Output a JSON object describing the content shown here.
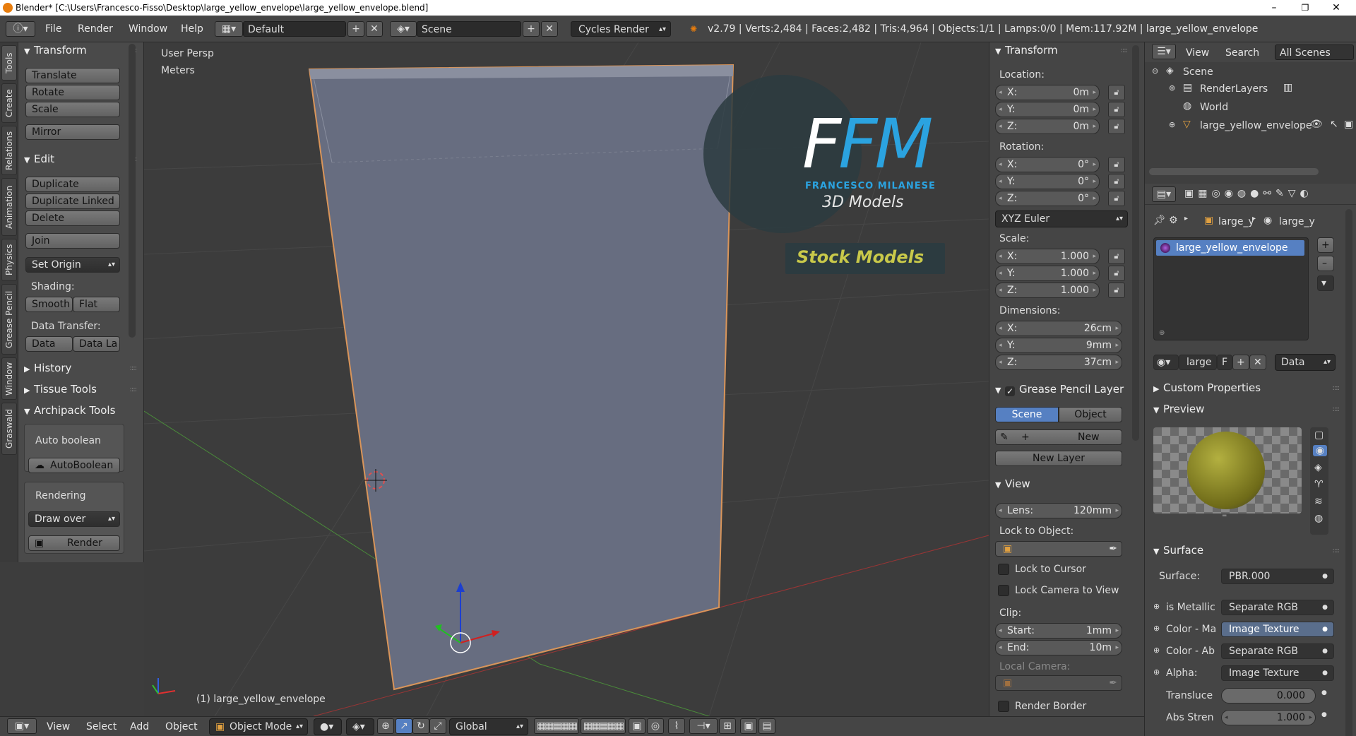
{
  "window": {
    "title": "Blender* [C:\\Users\\Francesco-Fisso\\Desktop\\large_yellow_envelope\\large_yellow_envelope.blend]",
    "min": "–",
    "max": "❐",
    "close": "✕"
  },
  "menu": {
    "items": [
      "File",
      "Render",
      "Window",
      "Help"
    ],
    "layout": "Default",
    "scene": "Scene",
    "engine": "Cycles Render",
    "stats": "v2.79 | Verts:2,484 | Faces:2,482 | Tris:4,964 | Objects:1/1 | Lamps:0/0 | Mem:117.92M | large_yellow_envelope"
  },
  "vtabs": [
    "Tools",
    "Create",
    "Relations",
    "Animation",
    "Physics",
    "Grease Pencil",
    "Window",
    "Graswald"
  ],
  "toolshelf": {
    "transform_header": "Transform",
    "translate": "Translate",
    "rotate": "Rotate",
    "scale": "Scale",
    "mirror": "Mirror",
    "edit_header": "Edit",
    "duplicate": "Duplicate",
    "duplicate_linked": "Duplicate Linked",
    "delete": "Delete",
    "join": "Join",
    "set_origin": "Set Origin",
    "shading_label": "Shading:",
    "smooth": "Smooth",
    "flat": "Flat",
    "data_transfer_label": "Data Transfer:",
    "data": "Data",
    "data_la": "Data La",
    "history": "History",
    "tissue": "Tissue Tools",
    "archipack": "Archipack Tools",
    "auto_boolean_label": "Auto boolean",
    "auto_boolean_btn": "AutoBoolean",
    "rendering_label": "Rendering",
    "draw_over": "Draw over",
    "render": "Render"
  },
  "viewport": {
    "view_name": "User Persp",
    "units": "Meters",
    "object_label": "(1) large_yellow_envelope",
    "watermark_initials": "FM",
    "watermark_name": "FRANCESCO MILANESE",
    "watermark_sub": "3D Models",
    "stock": "Stock Models"
  },
  "npanel": {
    "transform_header": "Transform",
    "location_label": "Location:",
    "location": [
      {
        "k": "X:",
        "v": "0m"
      },
      {
        "k": "Y:",
        "v": "0m"
      },
      {
        "k": "Z:",
        "v": "0m"
      }
    ],
    "rotation_label": "Rotation:",
    "rotation": [
      {
        "k": "X:",
        "v": "0°"
      },
      {
        "k": "Y:",
        "v": "0°"
      },
      {
        "k": "Z:",
        "v": "0°"
      }
    ],
    "rotation_mode": "XYZ Euler",
    "scale_label": "Scale:",
    "scale": [
      {
        "k": "X:",
        "v": "1.000"
      },
      {
        "k": "Y:",
        "v": "1.000"
      },
      {
        "k": "Z:",
        "v": "1.000"
      }
    ],
    "dimensions_label": "Dimensions:",
    "dimensions": [
      {
        "k": "X:",
        "v": "26cm"
      },
      {
        "k": "Y:",
        "v": "9mm"
      },
      {
        "k": "Z:",
        "v": "37cm"
      }
    ],
    "gp_header": "Grease Pencil Layer",
    "gp_scene": "Scene",
    "gp_object": "Object",
    "gp_new": "New",
    "gp_new_layer": "New Layer",
    "view_header": "View",
    "lens_k": "Lens:",
    "lens_v": "120mm",
    "lock_obj_label": "Lock to Object:",
    "lock_cursor": "Lock to Cursor",
    "lock_camera": "Lock Camera to View",
    "clip_label": "Clip:",
    "clip_start_k": "Start:",
    "clip_start_v": "1mm",
    "clip_end_k": "End:",
    "clip_end_v": "10m",
    "local_camera": "Local Camera:",
    "render_border": "Render Border"
  },
  "outliner": {
    "view": "View",
    "search": "Search",
    "all_scenes": "All Scenes",
    "scene": "Scene",
    "renderlayers": "RenderLayers",
    "world": "World",
    "object": "large_yellow_envelope"
  },
  "props": {
    "crumb1": "large_y",
    "crumb2": "large_y",
    "material_slot": "large_yellow_envelope",
    "mat_name": "large",
    "f": "F",
    "data_sel": "Data",
    "custom_props": "Custom Properties",
    "preview": "Preview",
    "surface_header": "Surface",
    "surface_label": "Surface:",
    "surface_val": "PBR.000",
    "rows": [
      {
        "k": "is Metallic",
        "v": "Separate RGB"
      },
      {
        "k": "Color - Ma",
        "v": "Image Texture"
      },
      {
        "k": "Color - Ab",
        "v": "Separate RGB"
      },
      {
        "k": "Alpha:",
        "v": "Image Texture"
      }
    ],
    "transl_k": "Transluce",
    "transl_v": "0.000",
    "abs_k": "Abs Stren",
    "abs_v": "1.000"
  },
  "bottom": {
    "view": "View",
    "select": "Select",
    "add": "Add",
    "object": "Object",
    "mode": "Object Mode",
    "orientation": "Global"
  }
}
